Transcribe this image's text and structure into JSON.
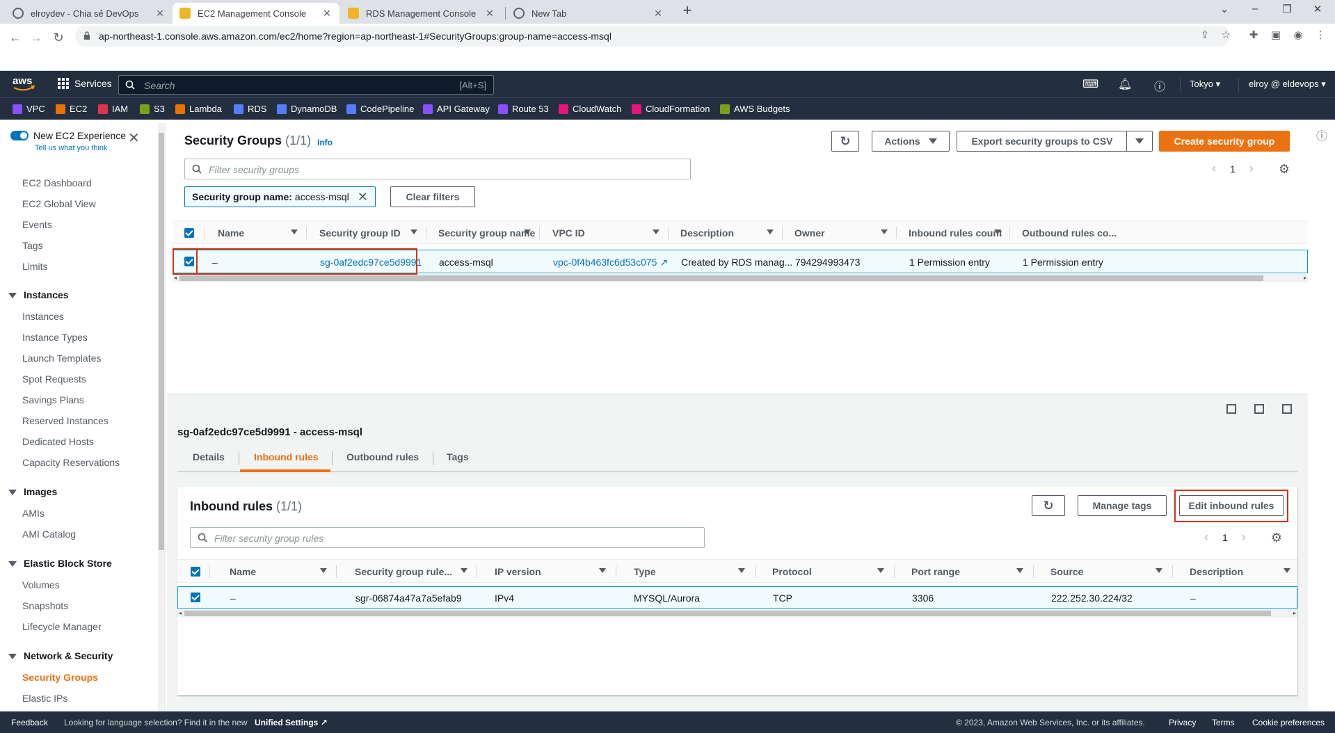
{
  "browser": {
    "tabs": [
      {
        "title": "elroydev - Chia sẻ DevOps",
        "icon_color": "#5f6368"
      },
      {
        "title": "EC2 Management Console",
        "icon_color": "#f0b429"
      },
      {
        "title": "RDS Management Console",
        "icon_color": "#f0b429"
      },
      {
        "title": "New Tab",
        "icon_color": "#5f6368"
      }
    ],
    "url": "ap-northeast-1.console.aws.amazon.com/ec2/home?region=ap-northeast-1#SecurityGroups:group-name=access-msql"
  },
  "aws_nav": {
    "logo": "aws",
    "services_label": "Services",
    "search_placeholder": "Search",
    "search_shortcut": "[Alt+S]",
    "region": "Tokyo",
    "account": "elroy @ eldevops"
  },
  "favorites": [
    {
      "label": "VPC",
      "color": "#8c4fff"
    },
    {
      "label": "EC2",
      "color": "#ed7100"
    },
    {
      "label": "IAM",
      "color": "#dd344c"
    },
    {
      "label": "S3",
      "color": "#7aa116"
    },
    {
      "label": "Lambda",
      "color": "#ed7100"
    },
    {
      "label": "RDS",
      "color": "#527fff"
    },
    {
      "label": "DynamoDB",
      "color": "#527fff"
    },
    {
      "label": "CodePipeline",
      "color": "#527fff"
    },
    {
      "label": "API Gateway",
      "color": "#8c4fff"
    },
    {
      "label": "Route 53",
      "color": "#8c4fff"
    },
    {
      "label": "CloudWatch",
      "color": "#e7157b"
    },
    {
      "label": "CloudFormation",
      "color": "#e7157b"
    },
    {
      "label": "AWS Budgets",
      "color": "#7aa116"
    }
  ],
  "sidebar": {
    "new_experience": "New EC2 Experience",
    "tell_us": "Tell us what you think",
    "top_items": [
      "EC2 Dashboard",
      "EC2 Global View",
      "Events",
      "Tags",
      "Limits"
    ],
    "sections": [
      {
        "title": "Instances",
        "items": [
          "Instances",
          "Instance Types",
          "Launch Templates",
          "Spot Requests",
          "Savings Plans",
          "Reserved Instances",
          "Dedicated Hosts",
          "Capacity Reservations"
        ]
      },
      {
        "title": "Images",
        "items": [
          "AMIs",
          "AMI Catalog"
        ]
      },
      {
        "title": "Elastic Block Store",
        "items": [
          "Volumes",
          "Snapshots",
          "Lifecycle Manager"
        ]
      },
      {
        "title": "Network & Security",
        "items": [
          "Security Groups",
          "Elastic IPs"
        ]
      }
    ]
  },
  "security_groups": {
    "title": "Security Groups",
    "count": "(1/1)",
    "info": "Info",
    "actions_label": "Actions",
    "export_label": "Export security groups to CSV",
    "create_label": "Create security group",
    "filter_placeholder": "Filter security groups",
    "filter_token_key": "Security group name:",
    "filter_token_value": "access-msql",
    "clear_filters": "Clear filters",
    "page": "1",
    "columns": [
      "Name",
      "Security group ID",
      "Security group name",
      "VPC ID",
      "Description",
      "Owner",
      "Inbound rules count",
      "Outbound rules co..."
    ],
    "row": {
      "name": "–",
      "group_id": "sg-0af2edc97ce5d9991",
      "group_name": "access-msql",
      "vpc_id": "vpc-0f4b463fc6d53c075",
      "description": "Created by RDS manag...",
      "owner": "794294993473",
      "inbound_count": "1 Permission entry",
      "outbound_count": "1 Permission entry"
    }
  },
  "details": {
    "title": "sg-0af2edc97ce5d9991 - access-msql",
    "tabs": [
      "Details",
      "Inbound rules",
      "Outbound rules",
      "Tags"
    ],
    "active_tab": "Inbound rules"
  },
  "inbound_rules": {
    "title": "Inbound rules",
    "count": "(1/1)",
    "manage_tags": "Manage tags",
    "edit_label": "Edit inbound rules",
    "filter_placeholder": "Filter security group rules",
    "page": "1",
    "columns": [
      "Name",
      "Security group rule...",
      "IP version",
      "Type",
      "Protocol",
      "Port range",
      "Source",
      "Description"
    ],
    "row": {
      "name": "–",
      "rule_id": "sgr-06874a47a7a5efab9",
      "ip_version": "IPv4",
      "type": "MYSQL/Aurora",
      "protocol": "TCP",
      "port_range": "3306",
      "source": "222.252.30.224/32",
      "description": "–"
    }
  },
  "footer": {
    "feedback": "Feedback",
    "language_msg": "Looking for language selection? Find it in the new",
    "unified_settings": "Unified Settings",
    "copyright": "© 2023, Amazon Web Services, Inc. or its affiliates.",
    "privacy": "Privacy",
    "terms": "Terms",
    "cookies": "Cookie preferences"
  }
}
